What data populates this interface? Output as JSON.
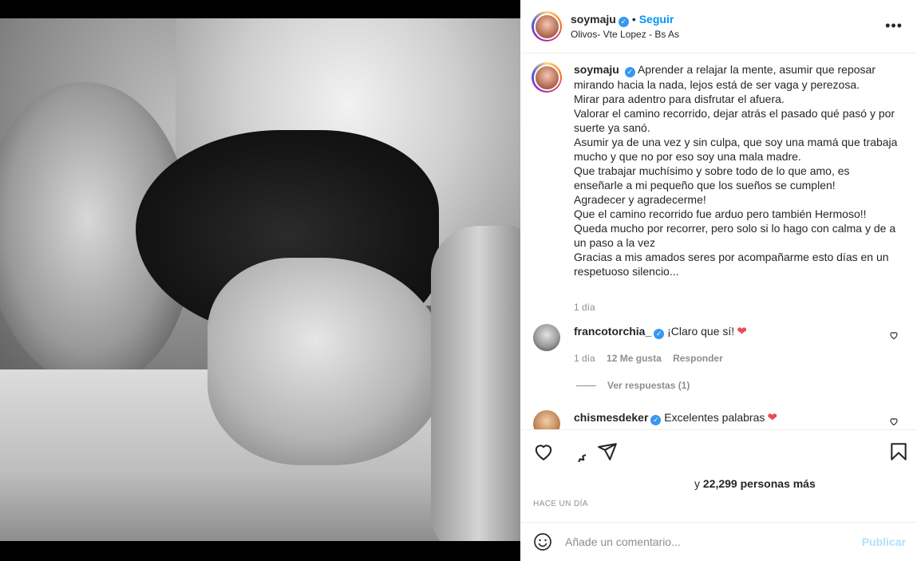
{
  "post": {
    "username": "soymaju",
    "follow_label": "Seguir",
    "separator": "•",
    "location": "Olivos- Vte Lopez - Bs As",
    "more_icon": "more-horizontal-icon",
    "verified_icon": "✓"
  },
  "caption": {
    "username": "soymaju",
    "text": "Aprender a relajar la mente, asumir que reposar mirando hacia la nada, lejos está de ser vaga y perezosa.\nMirar para adentro para disfrutar el afuera.\nValorar el camino recorrido, dejar atrás el pasado qué pasó y por suerte ya sanó.\nAsumir ya de una vez y sin culpa, que soy una mamá que trabaja mucho y que no por eso soy una mala madre.\nQue trabajar muchísimo y sobre todo de lo que amo, es enseñarle a mi pequeño que los sueños se cumplen!\nAgradecer y agradecerme!\nQue el camino recorrido fue arduo pero también Hermoso!!\nQueda mucho por recorrer, pero solo si lo hago con calma y de a un paso a la vez\nGracias a mis amados seres por acompañarme esto días en un respetuoso silencio...",
    "time": "1 día"
  },
  "comments": [
    {
      "username": "francotorchia_",
      "text": "¡Claro que sí!",
      "emoji": "❤",
      "time": "1 día",
      "likes": "12 Me gusta",
      "reply_label": "Responder",
      "view_replies": "Ver respuestas (1)"
    },
    {
      "username": "chismesdeker",
      "text": "Excelentes palabras",
      "emoji": "❤"
    }
  ],
  "actions": {
    "likes_text_prefix": "y ",
    "likes_count": "22,299 personas más",
    "posted": "HACE UN DÍA"
  },
  "comment_box": {
    "placeholder": "Añade un comentario...",
    "publish_label": "Publicar"
  },
  "colors": {
    "accent": "#0095f6",
    "verified": "#3897f0",
    "heart": "#ed4956",
    "muted": "#8e8e8e"
  }
}
